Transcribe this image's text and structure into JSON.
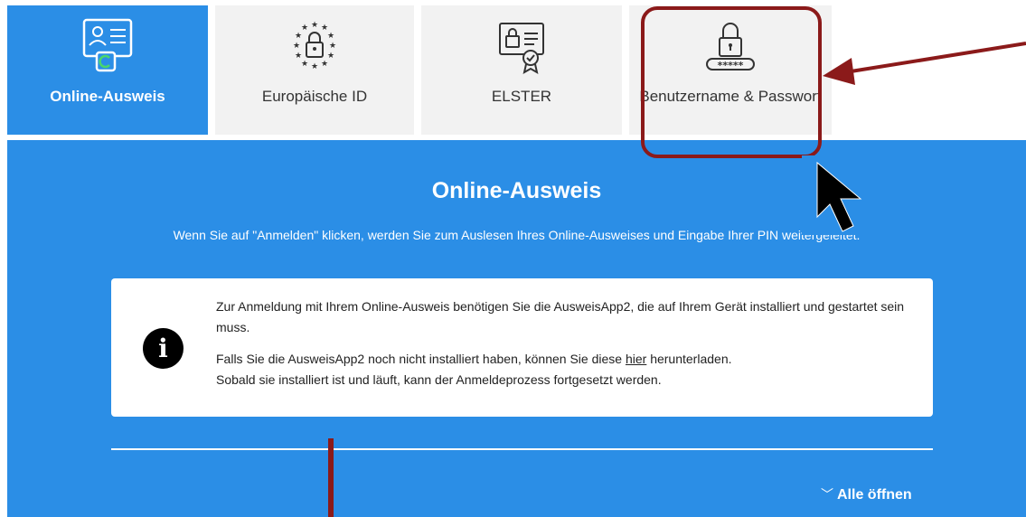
{
  "tabs": [
    {
      "label": "Online-Ausweis",
      "icon": "id-card-icon",
      "active": true
    },
    {
      "label": "Europäische ID",
      "icon": "eu-lock-icon",
      "active": false
    },
    {
      "label": "ELSTER",
      "icon": "certificate-lock-icon",
      "active": false
    },
    {
      "label": "Benutzername & Passwort",
      "icon": "password-lock-icon",
      "active": false
    }
  ],
  "panel": {
    "title": "Online-Ausweis",
    "subtitle": "Wenn Sie auf \"Anmelden\" klicken, werden Sie zum Auslesen Ihres Online-Ausweises und Eingabe Ihrer PIN weitergeleitet.",
    "info": {
      "icon": "info-icon",
      "icon_glyph": "i",
      "paragraph1": "Zur Anmeldung mit Ihrem Online-Ausweis benötigen Sie die AusweisApp2, die auf Ihrem Gerät installiert und gestartet sein muss.",
      "paragraph2_before": "Falls Sie die AusweisApp2 noch nicht installiert haben, können Sie diese ",
      "paragraph2_link": "hier",
      "paragraph2_after": " herunterladen.",
      "paragraph3": "Sobald sie installiert ist und läuft, kann der Anmeldeprozess fortgesetzt werden."
    },
    "expand_all": "Alle öffnen"
  },
  "colors": {
    "primary": "#2b8ee6",
    "tab_inactive": "#f2f2f2",
    "annotation": "#8b1a1a"
  }
}
